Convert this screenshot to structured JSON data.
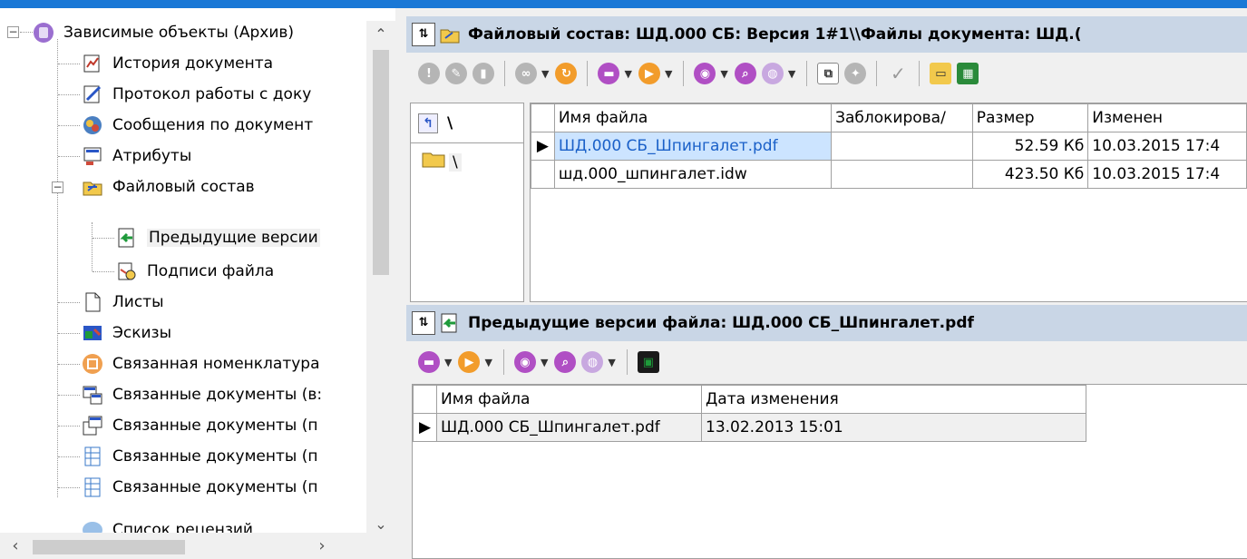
{
  "tree": {
    "items": [
      {
        "label": "Зависимые объекты (Архив)",
        "icon": "archive-icon"
      },
      {
        "label": "История документа",
        "icon": "history-icon"
      },
      {
        "label": "Протокол работы с доку",
        "icon": "protocol-icon"
      },
      {
        "label": "Сообщения по документ",
        "icon": "messages-icon"
      },
      {
        "label": "Атрибуты",
        "icon": "attributes-icon"
      },
      {
        "label": "Файловый состав",
        "icon": "file-folder-icon"
      },
      {
        "label": "Предыдущие версии",
        "icon": "previous-versions-icon"
      },
      {
        "label": "Подписи файла",
        "icon": "signature-icon"
      },
      {
        "label": "Листы",
        "icon": "sheet-icon"
      },
      {
        "label": "Эскизы",
        "icon": "sketch-icon"
      },
      {
        "label": "Связанная номенклатура",
        "icon": "nomenclature-icon"
      },
      {
        "label": "Связанные документы (в:",
        "icon": "linked-docs-icon"
      },
      {
        "label": "Связанные документы (п",
        "icon": "linked-docs-icon"
      },
      {
        "label": "Связанные документы (п",
        "icon": "linked-docs-icon"
      },
      {
        "label": "Связанные документы (п",
        "icon": "linked-docs-icon"
      },
      {
        "label": "Список рецензий",
        "icon": "reviews-icon"
      }
    ]
  },
  "top_panel": {
    "title": "Файловый состав: ШД.000 СБ: Версия 1#1\\\\Файлы документа: ШД.(",
    "folder_header": "\\",
    "folder_item": "\\",
    "columns": [
      "Имя файла",
      "Заблокирова/",
      "Размер",
      "Изменен"
    ],
    "rows": [
      [
        "ШД.000 СБ_Шпингалет.pdf",
        "",
        "52.59 Кб",
        "10.03.2015 17:4"
      ],
      [
        "шд.000_шпингалет.idw",
        "",
        "423.50 Кб",
        "10.03.2015 17:4"
      ]
    ]
  },
  "bottom_panel": {
    "title": "Предыдущие версии файла: ШД.000 СБ_Шпингалет.pdf",
    "columns": [
      "Имя файла",
      "Дата изменения"
    ],
    "rows": [
      [
        "ШД.000 СБ_Шпингалет.pdf",
        "13.02.2013 15:01"
      ]
    ]
  },
  "colors": {
    "accent_bar": "#1a78d6",
    "title_bg": "#c9d6e6",
    "selection": "#cce4ff"
  }
}
